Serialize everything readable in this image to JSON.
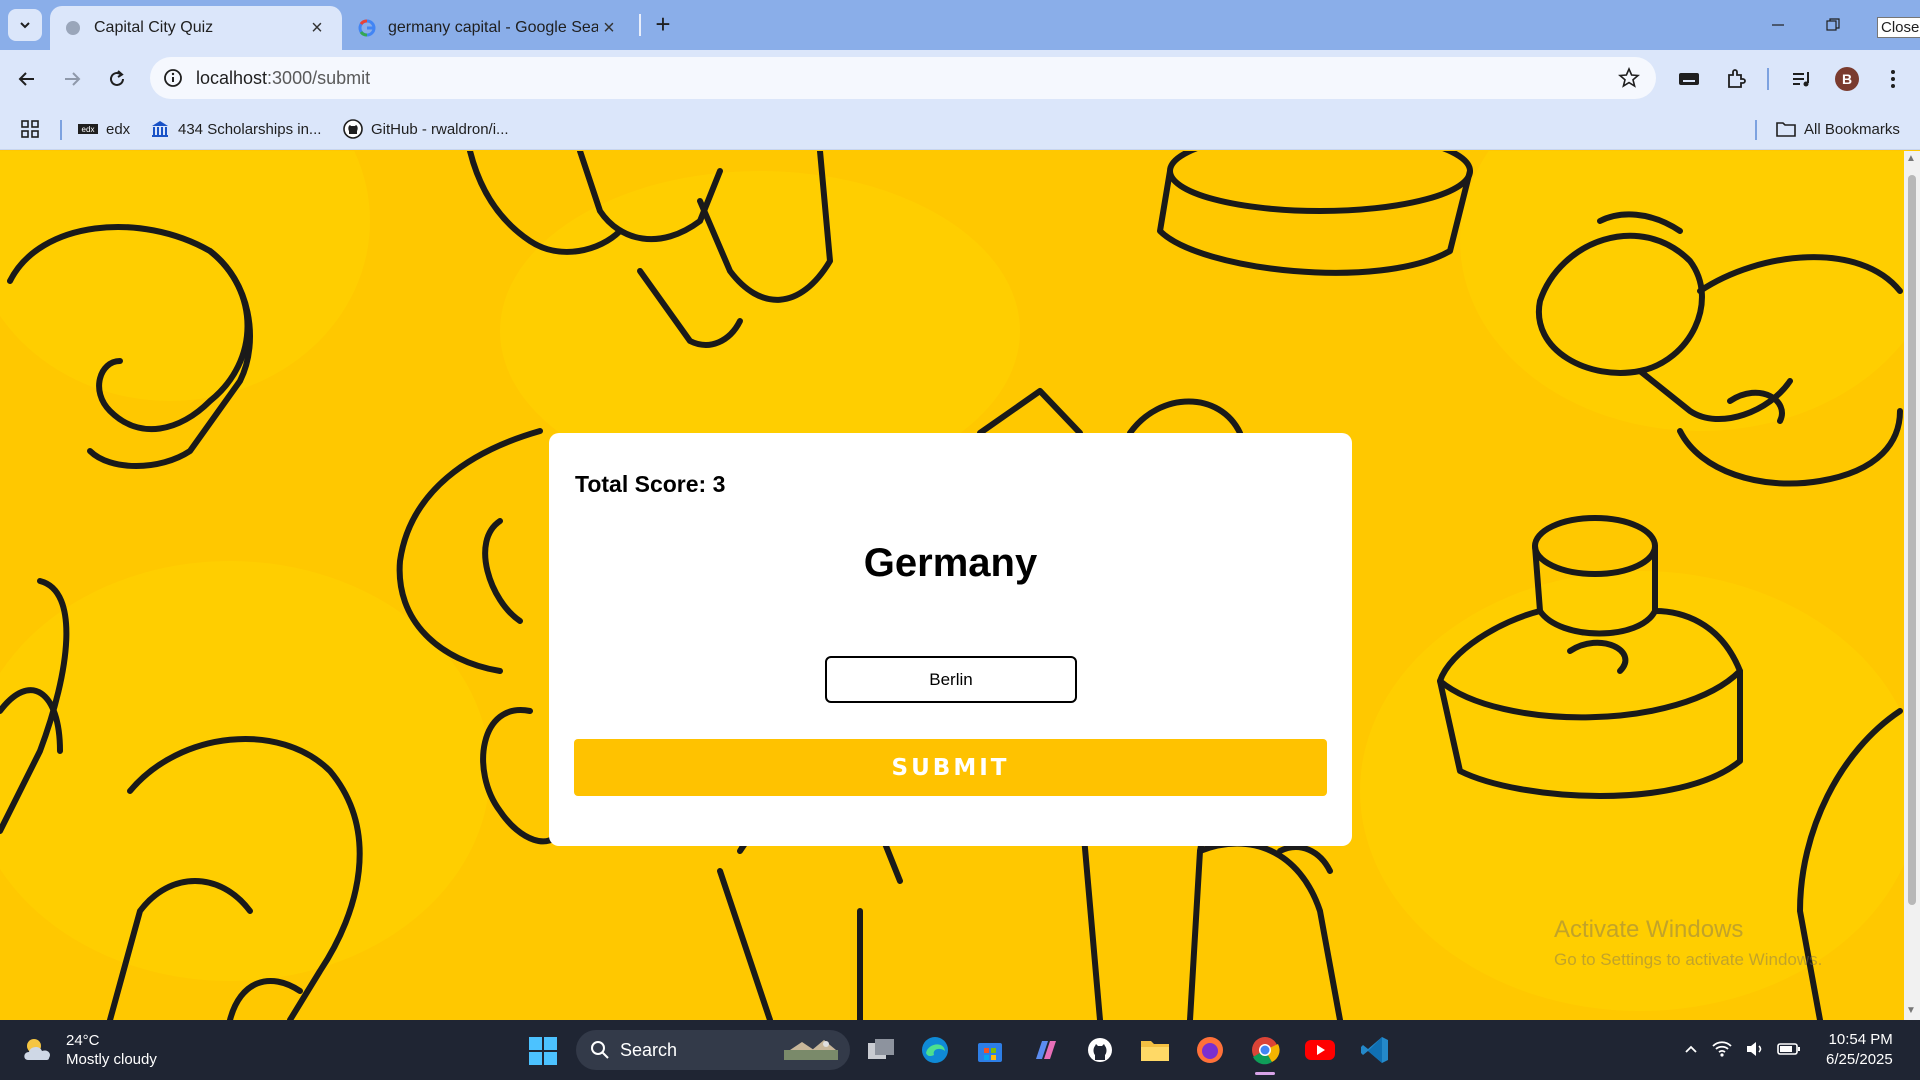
{
  "browser": {
    "tabs": [
      {
        "title": "Capital City Quiz",
        "active": true
      },
      {
        "title": "germany capital - Google Search",
        "active": false
      }
    ],
    "tooltip": "Close",
    "address": {
      "host": "localhost",
      "path": ":3000/submit"
    },
    "bookmarks": [
      {
        "label": "edx",
        "icon": "edx-icon"
      },
      {
        "label": "434 Scholarships in...",
        "icon": "scholarship-icon"
      },
      {
        "label": "GitHub - rwaldron/i...",
        "icon": "github-icon"
      }
    ],
    "all_bookmarks": "All Bookmarks",
    "profile_initial": "B"
  },
  "quiz": {
    "score_label": "Total Score: 3",
    "country": "Germany",
    "answer_value": "Berlin",
    "submit_label": "SUBMIT"
  },
  "watermark": {
    "line1": "Activate Windows",
    "line2": "Go to Settings to activate Windows."
  },
  "taskbar": {
    "weather_temp": "24°C",
    "weather_desc": "Mostly cloudy",
    "search_label": "Search",
    "time": "10:54 PM",
    "date": "6/25/2025"
  },
  "colors": {
    "page_bg": "#ffc800",
    "button": "#ffc200",
    "chrome": "#dbe6fa",
    "taskbar": "#1f2533"
  }
}
